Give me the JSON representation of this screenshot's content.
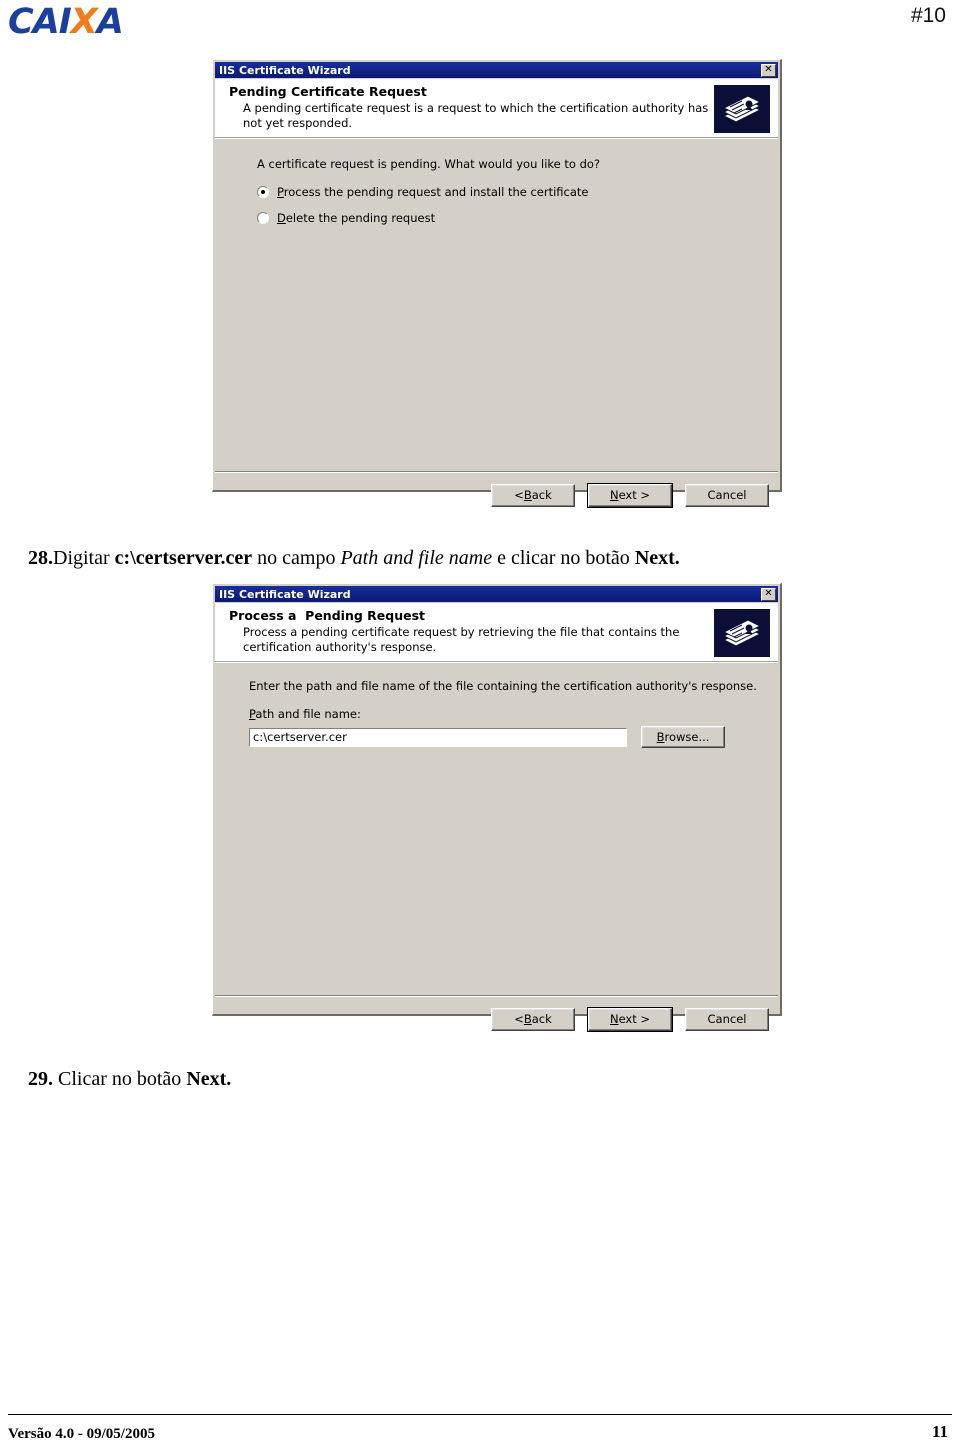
{
  "page": {
    "brand": "CAIXA",
    "brand_letters_before": "CAI",
    "brand_letter_accent": "X",
    "brand_letters_after": "A",
    "marker": "#10",
    "footer_version": "Versão 4.0 - 09/05/2005",
    "footer_page_number": "11",
    "colors": {
      "brand_blue": "#1b3f9c",
      "brand_orange": "#f07d1a",
      "titlebar_blue": "#10228c",
      "dialog_face": "#d4d0c8",
      "icon_background": "#0c1038"
    }
  },
  "dialog1": {
    "titlebar": {
      "title": "IIS Certificate Wizard",
      "close_label": "✕"
    },
    "header": {
      "title": "Pending Certificate Request",
      "description": "A pending certificate request is a request to which the certification authority has not yet responded.",
      "icon": "certificates-stack-icon"
    },
    "body": {
      "prompt": "A certificate request is pending. What would you like to do?",
      "options": [
        {
          "accel": "P",
          "rest": "rocess the pending request and install the certificate",
          "selected": true
        },
        {
          "accel": "D",
          "rest": "elete the pending request",
          "selected": false
        }
      ]
    },
    "buttons": {
      "back_prefix": "< ",
      "back_accel": "B",
      "back_rest": "ack",
      "next_accel": "N",
      "next_rest": "ext >",
      "cancel": "Cancel"
    }
  },
  "step28": {
    "number": "28.",
    "t1": "Digitar ",
    "bold1": "c:\\certserver.cer",
    "t2": " no campo ",
    "italic1": "Path and file name",
    "t3": " e clicar no botão ",
    "bold2": "Next."
  },
  "dialog2": {
    "titlebar": {
      "title": "IIS Certificate Wizard",
      "close_label": "✕"
    },
    "header": {
      "title": "Process a  Pending Request",
      "description": "Process a pending certificate request by retrieving the file that contains the certification authority's response.",
      "icon": "certificates-stack-icon"
    },
    "body": {
      "prompt": "Enter the path and file name of the file containing the certification authority's response.",
      "field_accel": "P",
      "field_label_rest": "ath and file name:",
      "field_value": "c:\\certserver.cer",
      "field_placeholder": "",
      "browse_accel": "B",
      "browse_pre": "",
      "browse_rest": "rowse..."
    },
    "buttons": {
      "back_prefix": "< ",
      "back_accel": "B",
      "back_rest": "ack",
      "next_accel": "N",
      "next_rest": "ext >",
      "cancel": "Cancel"
    }
  },
  "step29": {
    "number": "29.",
    "t1": " Clicar no botão ",
    "bold1": "Next."
  }
}
